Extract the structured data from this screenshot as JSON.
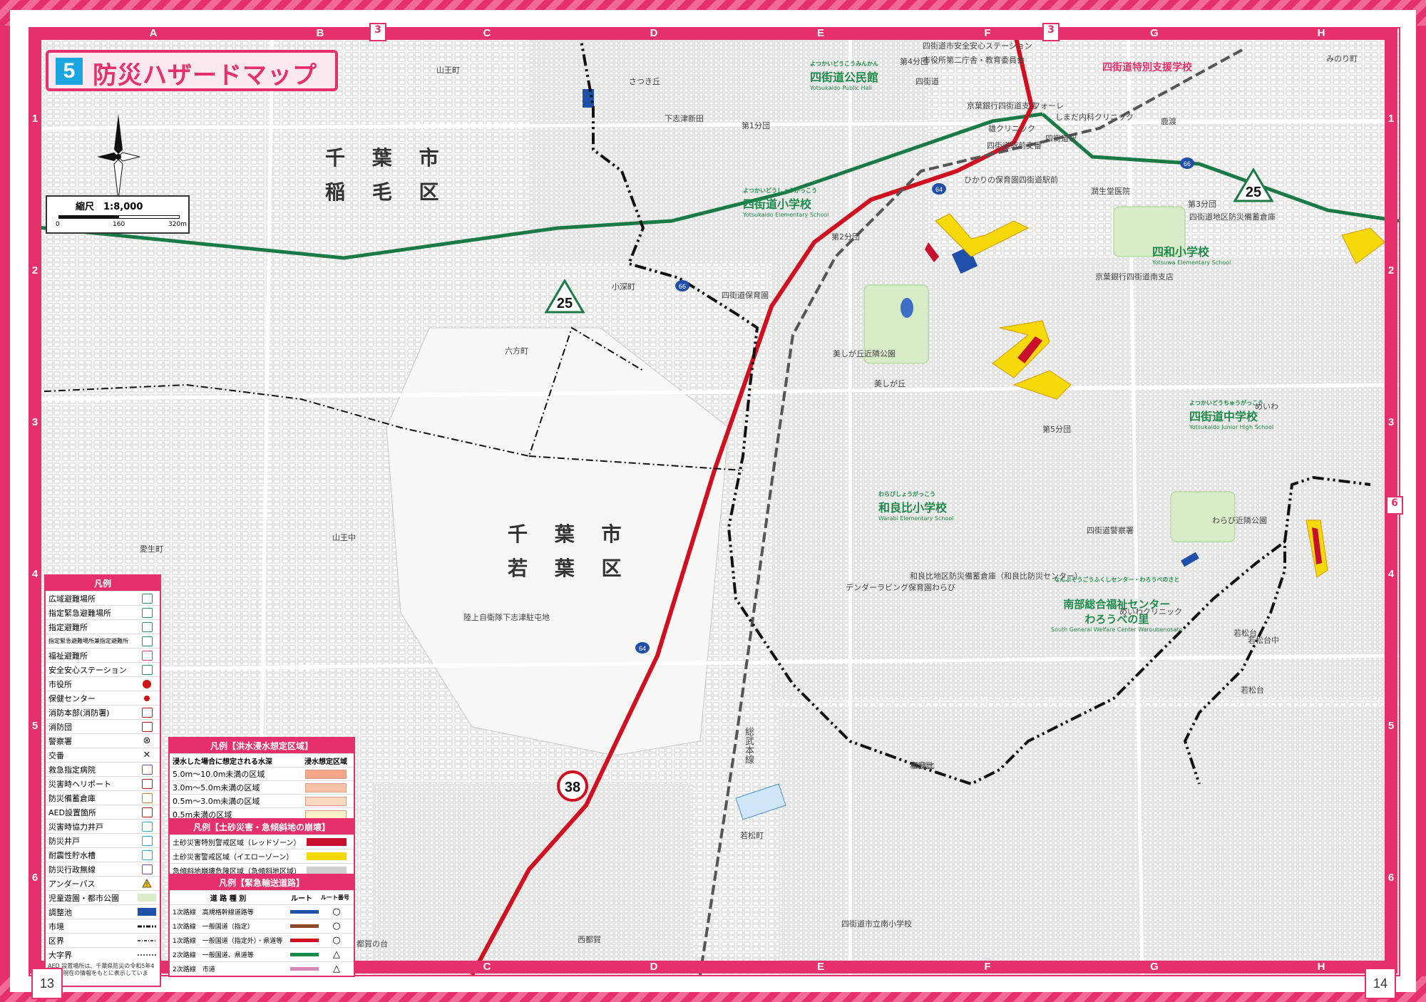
{
  "title": {
    "number": "5",
    "text": "防災ハザードマップ"
  },
  "page_numbers": {
    "left": "13",
    "right": "14",
    "top_ref_a": "3",
    "top_ref_b": "3",
    "side_ref": "6"
  },
  "grid": {
    "columns": [
      "A",
      "B",
      "C",
      "D",
      "E",
      "F",
      "G",
      "H"
    ],
    "rows": [
      "1",
      "2",
      "3",
      "4",
      "5",
      "6"
    ]
  },
  "scale": {
    "label": "縮尺　1:8,000",
    "ticks": [
      "0",
      "160",
      "320m"
    ]
  },
  "districts": [
    {
      "id": "inage",
      "lines": [
        "千 葉 市",
        "稲 毛 区"
      ]
    },
    {
      "id": "wakaba",
      "lines": [
        "千 葉 市",
        "若 葉 区"
      ]
    }
  ],
  "route_shields": [
    {
      "id": "r25a",
      "label": "25"
    },
    {
      "id": "r25b",
      "label": "25"
    },
    {
      "id": "r38",
      "label": "38"
    },
    {
      "id": "r64a",
      "label": "64"
    },
    {
      "id": "r64b",
      "label": "64"
    },
    {
      "id": "r66a",
      "label": "66"
    },
    {
      "id": "r66b",
      "label": "66"
    }
  ],
  "facilities": [
    {
      "id": "kominkan",
      "name": "四街道公民館",
      "sub": "Yotsukaido Public Hall",
      "ruby": "よつかいどうこうみんかん"
    },
    {
      "id": "yotsukaido-es",
      "name": "四街道小学校",
      "sub": "Yotsukaido Elementary School",
      "ruby": "よつかいどうしょうがっこう"
    },
    {
      "id": "yowa-es",
      "name": "四和小学校",
      "sub": "Yotsuwa Elementary School",
      "ruby": "よつわしょうがっこう"
    },
    {
      "id": "yotsukaido-jhs",
      "name": "四街道中学校",
      "sub": "Yotsukaido Junior High School",
      "ruby": "よつかいどうちゅうがっこう"
    },
    {
      "id": "warabi-es",
      "name": "和良比小学校",
      "sub": "Warabi Elementary School",
      "ruby": "わらびしょうがっこう"
    },
    {
      "id": "warobe",
      "name": "南部総合福祉センター\nわろうべの里",
      "sub": "South General Welfare Center Waroubenosato",
      "ruby": "なんぶそうごうふくしセンター・わろうべのさと"
    },
    {
      "id": "tokubetsu",
      "name": "四街道特別支援学校",
      "sub": "",
      "ruby": ""
    }
  ],
  "place_labels": [
    "四街道市安全安心ステーション",
    "市役所第二庁舎・教育委員会",
    "第4分団",
    "四街道",
    "京葉銀行四街道支店",
    "フォーレ",
    "しまだ内科クリニック",
    "雄クリニック",
    "四街道駅前交番",
    "四街道駅",
    "ひかりの保育園四街道駅前",
    "潤生堂医院",
    "第3分団",
    "四街道地区防災備蓄倉庫",
    "京葉銀行四街道南支店",
    "四街道保育園",
    "美しが丘近隣公園",
    "美しが丘",
    "第5分団",
    "四街道警察署",
    "和良比地区防災備蓄倉庫（和良比防災センター）",
    "デンダーラビング保育園わらび",
    "めいわクリニック",
    "わらび近隣公園",
    "若松台",
    "めいわ",
    "和良比",
    "若松町",
    "鹿渡",
    "和良比",
    "みのり町",
    "さつき丘",
    "下志津新田",
    "第1分団",
    "第2分団",
    "小深町",
    "六方町",
    "山王町",
    "山王中",
    "愛生町",
    "陸上自衛隊下志津駐屯地",
    "西都賀",
    "都賀の台",
    "若松台",
    "総武本線",
    "若松台中",
    "四街道市立南小学校"
  ],
  "legend": {
    "title": "凡例",
    "items": [
      {
        "label": "広域避難場所",
        "icon": "wide-area-evacuation-icon",
        "color": "#1a9c56"
      },
      {
        "label": "指定緊急避難場所",
        "icon": "emergency-evacuation-icon",
        "color": "#1a9c56"
      },
      {
        "label": "指定避難所",
        "icon": "shelter-icon",
        "color": "#1a9c56"
      },
      {
        "label": "指定緊急避難場所兼指定避難所",
        "icon": "combined-shelter-icon",
        "color": "#1a9c56"
      },
      {
        "label": "福祉避難所",
        "icon": "welfare-shelter-icon",
        "color": "#e6306b"
      },
      {
        "label": "安全安心ステーション",
        "icon": "safety-station-icon",
        "color": "#1a9c56"
      },
      {
        "label": "市役所",
        "icon": "city-hall-icon",
        "color": "#d01010"
      },
      {
        "label": "保健センター",
        "icon": "health-center-icon",
        "color": "#d01010"
      },
      {
        "label": "消防本部(消防署)",
        "icon": "fire-hq-icon",
        "color": "#d01010"
      },
      {
        "label": "消防団",
        "icon": "fire-brigade-icon",
        "color": "#d01010"
      },
      {
        "label": "警察署",
        "icon": "police-station-icon",
        "color": "#222222"
      },
      {
        "label": "交番",
        "icon": "police-box-icon",
        "color": "#222222"
      },
      {
        "label": "救急指定病院",
        "icon": "hospital-icon",
        "color": "#8a3fb0"
      },
      {
        "label": "災害時ヘリポート",
        "icon": "heliport-icon",
        "color": "#d01010"
      },
      {
        "label": "防災備蓄倉庫",
        "icon": "storage-icon",
        "color": "#d47a1a"
      },
      {
        "label": "AED設置箇所",
        "icon": "aed-icon",
        "color": "#d01010"
      },
      {
        "label": "災害時協力井戸",
        "icon": "coop-well-icon",
        "color": "#1aa6e0"
      },
      {
        "label": "防災井戸",
        "icon": "disaster-well-icon",
        "color": "#1aa6e0"
      },
      {
        "label": "耐震性貯水槽",
        "icon": "water-tank-icon",
        "color": "#1aa6e0"
      },
      {
        "label": "防災行政無線",
        "icon": "radio-icon",
        "color": "#8a3fb0"
      },
      {
        "label": "アンダーパス",
        "icon": "underpass-icon",
        "color": "#f0c000"
      },
      {
        "label": "児童遊園・都市公園",
        "icon": "park-swatch",
        "color": "#d8ecc8"
      },
      {
        "label": "調整池",
        "icon": "pond-swatch",
        "color": "#1f4fa8"
      },
      {
        "label": "市境",
        "icon": "city-boundary-line",
        "color": "#111111"
      },
      {
        "label": "区界",
        "icon": "ward-boundary-line",
        "color": "#111111"
      },
      {
        "label": "大字界",
        "icon": "oaza-boundary-line",
        "color": "#111111"
      }
    ],
    "note": "AED 設置場所は、千葉県防災の令和5年4月1日現在の情報をもとに表示しています。"
  },
  "flood_legend": {
    "title": "凡例【洪水浸水想定区域】",
    "header": [
      "浸水した場合に想定される水深",
      "浸水想定区域"
    ],
    "rows": [
      {
        "label": "5.0m～10.0m未満の区域",
        "color": "#f4a58a"
      },
      {
        "label": "3.0m～5.0m未満の区域",
        "color": "#f8c0a5"
      },
      {
        "label": "0.5m～3.0m未満の区域",
        "color": "#fad8c0"
      },
      {
        "label": "0.5m未満の区域",
        "color": "#fdf1c5"
      }
    ]
  },
  "landslide_legend": {
    "title": "凡例【土砂災害・急傾斜地の崩壊】",
    "rows": [
      {
        "label": "土砂災害特別警戒区域（レッドゾーン）",
        "color": "#c8102e"
      },
      {
        "label": "土砂災害警戒区域（イエローゾーン）",
        "color": "#f5d90a"
      },
      {
        "label": "急傾斜地崩壊危険区域（急傾斜地区域）",
        "color": "#cfcfcf"
      }
    ]
  },
  "route_legend": {
    "title": "凡例【緊急輸送道路】",
    "header": [
      "道 路 種 別",
      "ルート",
      "ルート番号"
    ],
    "rows": [
      {
        "label": "1次路線　高規格幹線道路等",
        "color": "#1f4fa8",
        "marker": "○"
      },
      {
        "label": "1次路線　一般国道（指定）",
        "color": "#8b4a2b",
        "marker": "○"
      },
      {
        "label": "1次路線　一般国道（指定外）・県道等",
        "color": "#d01020",
        "marker": "○"
      },
      {
        "label": "2次路線　一般国道、県道等",
        "color": "#1a8a4a",
        "marker": "△"
      },
      {
        "label": "2次路線　市道",
        "color": "#d888b8",
        "marker": "△"
      }
    ]
  },
  "map_colors": {
    "accent": "#e6306b",
    "red_route": "#d01020",
    "green_route": "#1a7a45",
    "boundary": "#111111",
    "yellow_zone": "#f5d90a",
    "pond": "#1f4fa8"
  }
}
